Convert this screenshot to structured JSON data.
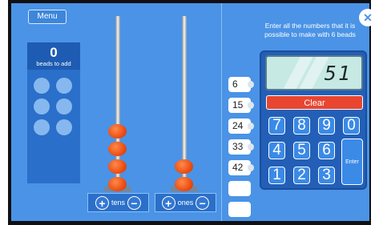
{
  "menu": {
    "label": "Menu"
  },
  "beads_panel": {
    "count": "0",
    "label": "beads to add",
    "empty_slots": 6
  },
  "abacus": {
    "tens_beads": 4,
    "ones_beads": 2,
    "tens_label": "tens",
    "ones_label": "ones",
    "plus_symbol": "+",
    "minus_symbol": "−"
  },
  "answers": [
    "6",
    "15",
    "24",
    "33",
    "42",
    "",
    ""
  ],
  "instruction": "Enter all the numbers that it is possible to make with 6 beads",
  "close_symbol": "✕",
  "calculator": {
    "display": "51",
    "clear_label": "Clear",
    "enter_label": "Enter",
    "keys": [
      "7",
      "8",
      "9",
      "0",
      "4",
      "5",
      "6",
      "1",
      "2",
      "3"
    ]
  },
  "colors": {
    "background": "#4a93e6",
    "panel": "#2a6fc9",
    "bead": "#ea4a10",
    "clear": "#e84631",
    "display": "#c7e9e4"
  }
}
